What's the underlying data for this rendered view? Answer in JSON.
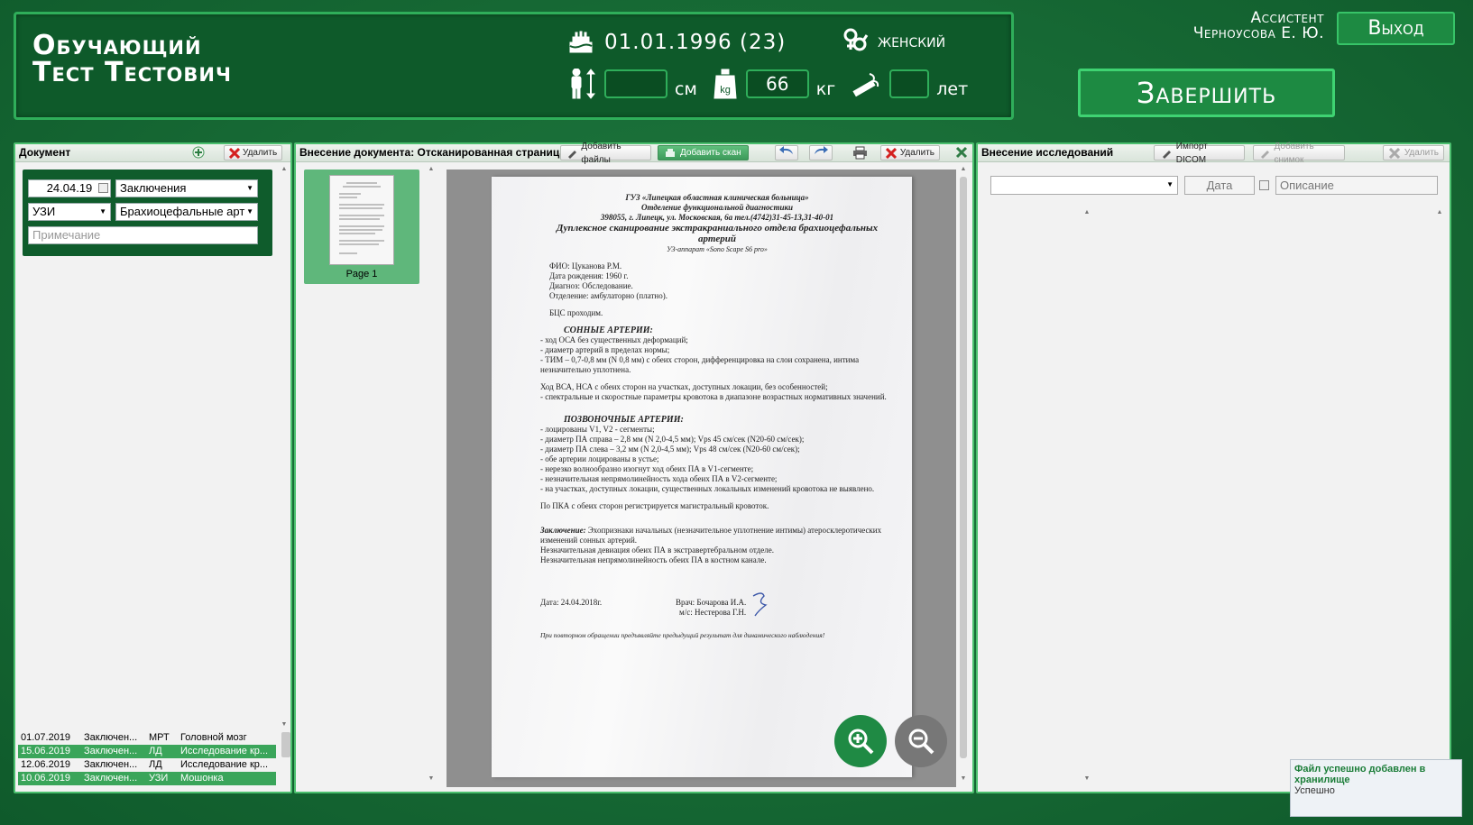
{
  "patient": {
    "name_line1": "Обучающий",
    "name_line2": "Тест Тестович",
    "birthdate": "01.01.1996 (23)",
    "sex": "женский",
    "height_value": "",
    "height_unit": "см",
    "weight_value": "66",
    "weight_unit": "кг",
    "smoking_value": "",
    "smoking_unit": "лет"
  },
  "user": {
    "role": "Ассистент",
    "name": "Черноусова Е. Ю.",
    "logout_label": "Выход",
    "finish_label": "Завершить"
  },
  "document_panel": {
    "title": "Документ",
    "delete_label": "Удалить",
    "date": "24.04.19",
    "doc_type": "Заключения",
    "modality": "УЗИ",
    "study": "Брахиоцефальные арт",
    "note_placeholder": "Примечание",
    "rows": [
      {
        "date": "01.07.2019",
        "type": "Заключен...",
        "mod": "МРТ",
        "desc": "Головной мозг"
      },
      {
        "date": "15.06.2019",
        "type": "Заключен...",
        "mod": "ЛД",
        "desc": "Исследование кр..."
      },
      {
        "date": "12.06.2019",
        "type": "Заключен...",
        "mod": "ЛД",
        "desc": "Исследование кр..."
      },
      {
        "date": "10.06.2019",
        "type": "Заключен...",
        "mod": "УЗИ",
        "desc": "Мошонка"
      }
    ]
  },
  "scan_panel": {
    "title": "Внесение документа: Отсканированная страница",
    "add_files_label": "Добавить файлы",
    "add_scan_label": "Добавить скан",
    "delete_label": "Удалить",
    "page_label": "Page 1"
  },
  "scan_document": {
    "org": "ГУЗ «Липецкая областная клиническая больница»",
    "dept": "Отделение функциональной диагностики",
    "address": "398055, г. Липецк, ул. Московская, 6а тел.(4742)31-45-13,31-40-01",
    "title": "Дуплексное сканирование экстракраниального отдела брахиоцефальных артерий",
    "device": "УЗ-аппарат «Sono Scape S6 pro»",
    "fio": "ФИО:  Цуканова Р.М.",
    "dob": "Дата рождения: 1960 г.",
    "diagnosis": "Диагноз: Обследование.",
    "department": "Отделение:  амбулаторно (платно).",
    "bcs": "БЦС проходим.",
    "carotid_title": "СОННЫЕ АРТЕРИИ:",
    "carotid_1": "- ход ОСА без существенных деформаций;",
    "carotid_2": "- диаметр артерий в пределах нормы;",
    "carotid_3": "- ТИМ – 0,7-0,8 мм (N 0,8 мм) с обеих сторон, дифференцировка на слои сохранена, интима незначительно уплотнена.",
    "vsa_1": "Ход ВСА, НСА с обеих сторон на участках, доступных локации, без особенностей;",
    "vsa_2": "- спектральные и скоростные параметры кровотока в диапазоне возрастных нормативных значений.",
    "vert_title": "ПОЗВОНОЧНЫЕ АРТЕРИИ:",
    "vert_1": "- лоцированы V1, V2 - сегменты;",
    "vert_2": "- диаметр ПА справа – 2,8 мм (N 2,0-4,5 мм); Vps 45 см/сек (N20-60 см/сек);",
    "vert_3": "- диаметр ПА слева – 3,2 мм (N 2,0-4,5 мм); Vps 48 см/сек (N20-60 см/сек);",
    "vert_4": "- обе артерии лоцированы в устье;",
    "vert_5": "- нерезко волнообразно изогнут ход обеих ПА в V1-сегменте;",
    "vert_6": "- незначительная непрямолинейность  хода обеих  ПА в V2-сегменте;",
    "vert_7": "- на участках, доступных локации, существенных локальных изменений кровотока не выявлено.",
    "pka": "По ПКА с обеих сторон регистрируется магистральный кровоток.",
    "concl_label": "Заключение:",
    "concl_1": "Эхопризнаки начальных (незначительное уплотнение интимы) атеросклеротических изменений сонных артерий.",
    "concl_2": "Незначительная девиация обеих ПА в экстравертебральном отделе.",
    "concl_3": "Незначительная непрямолинейность обеих ПА в костном канале.",
    "date": "Дата: 24.04.2018г.",
    "doctor": "Врач: Бочарова И.А.",
    "nurse": "м/с: Нестерова Г.Н.",
    "footer": "При повторном обращении предъявляйте предыдущий результат для динамического наблюдения!"
  },
  "study_panel": {
    "title": "Внесение исследований",
    "import_label": "Импорт DICOM",
    "add_image_label": "Добавить снимок",
    "delete_label": "Удалить",
    "date_placeholder": "Дата",
    "desc_placeholder": "Описание"
  },
  "toast": {
    "title": "Файл успешно добавлен в хранилище",
    "status": "Успешно"
  },
  "colors": {
    "background": "#176a35",
    "accent": "#3fd372",
    "selected_row": "#3aa55a",
    "zoom_in": "#1f8a44"
  }
}
